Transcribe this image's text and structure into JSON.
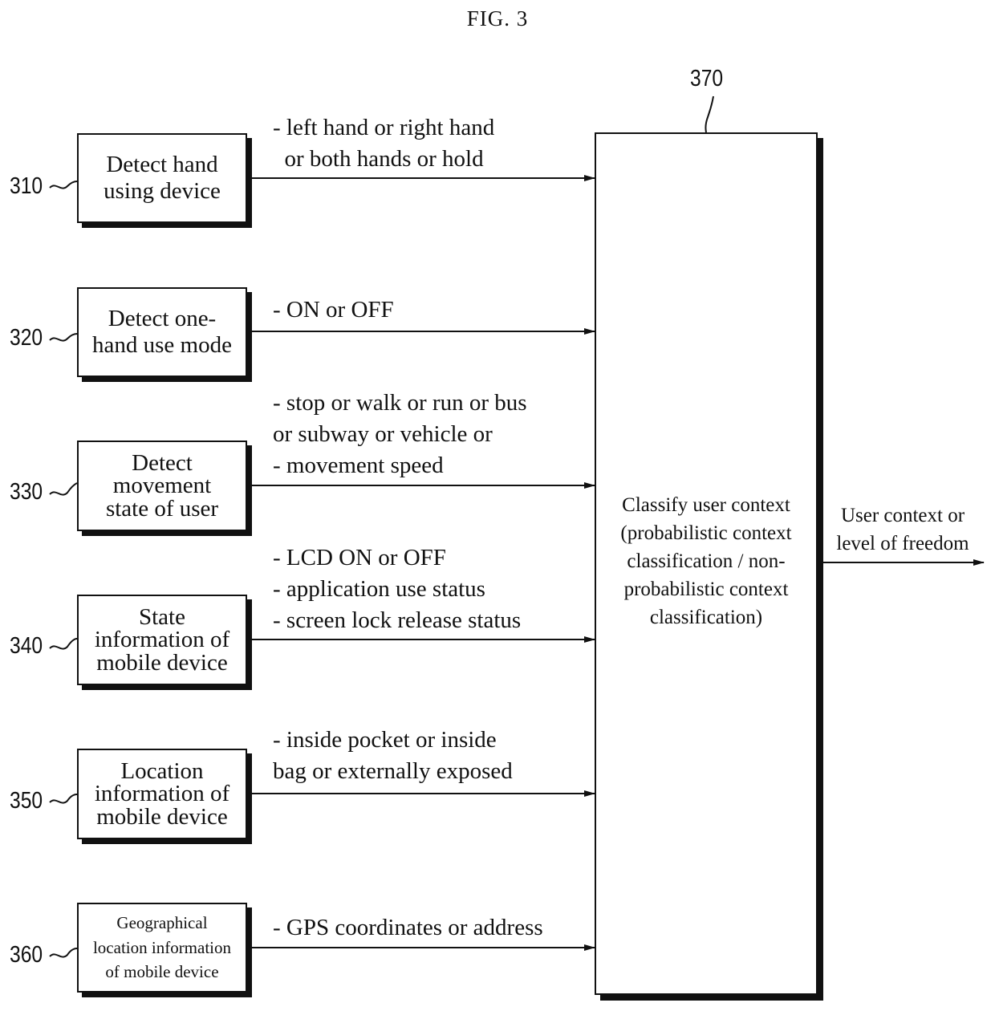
{
  "figure": {
    "title": "FIG. 3"
  },
  "inputs": [
    {
      "ref": "310",
      "label": "Detect hand\nusing device",
      "arrow_label": "- left hand or right hand\n  or both hands or hold"
    },
    {
      "ref": "320",
      "label": "Detect one-\nhand use mode",
      "arrow_label": "- ON or OFF"
    },
    {
      "ref": "330",
      "label": "Detect\nmovement\nstate of user",
      "arrow_label": "- stop or walk or run or bus\nor subway or vehicle or\n- movement speed"
    },
    {
      "ref": "340",
      "label": "State\ninformation of\nmobile device",
      "arrow_label": "- LCD ON or OFF\n- application use status\n- screen lock release status"
    },
    {
      "ref": "350",
      "label": "Location\ninformation of\nmobile device",
      "arrow_label": "- inside pocket or inside\nbag or externally exposed"
    },
    {
      "ref": "360",
      "label": "Geographical\nlocation information\nof mobile device",
      "arrow_label": "- GPS coordinates or address"
    }
  ],
  "classifier": {
    "ref": "370",
    "label": "Classify user context\n(probabilistic context\nclassification / non-\nprobabilistic context\nclassification)"
  },
  "output": {
    "label": "User context or\nlevel of freedom"
  }
}
